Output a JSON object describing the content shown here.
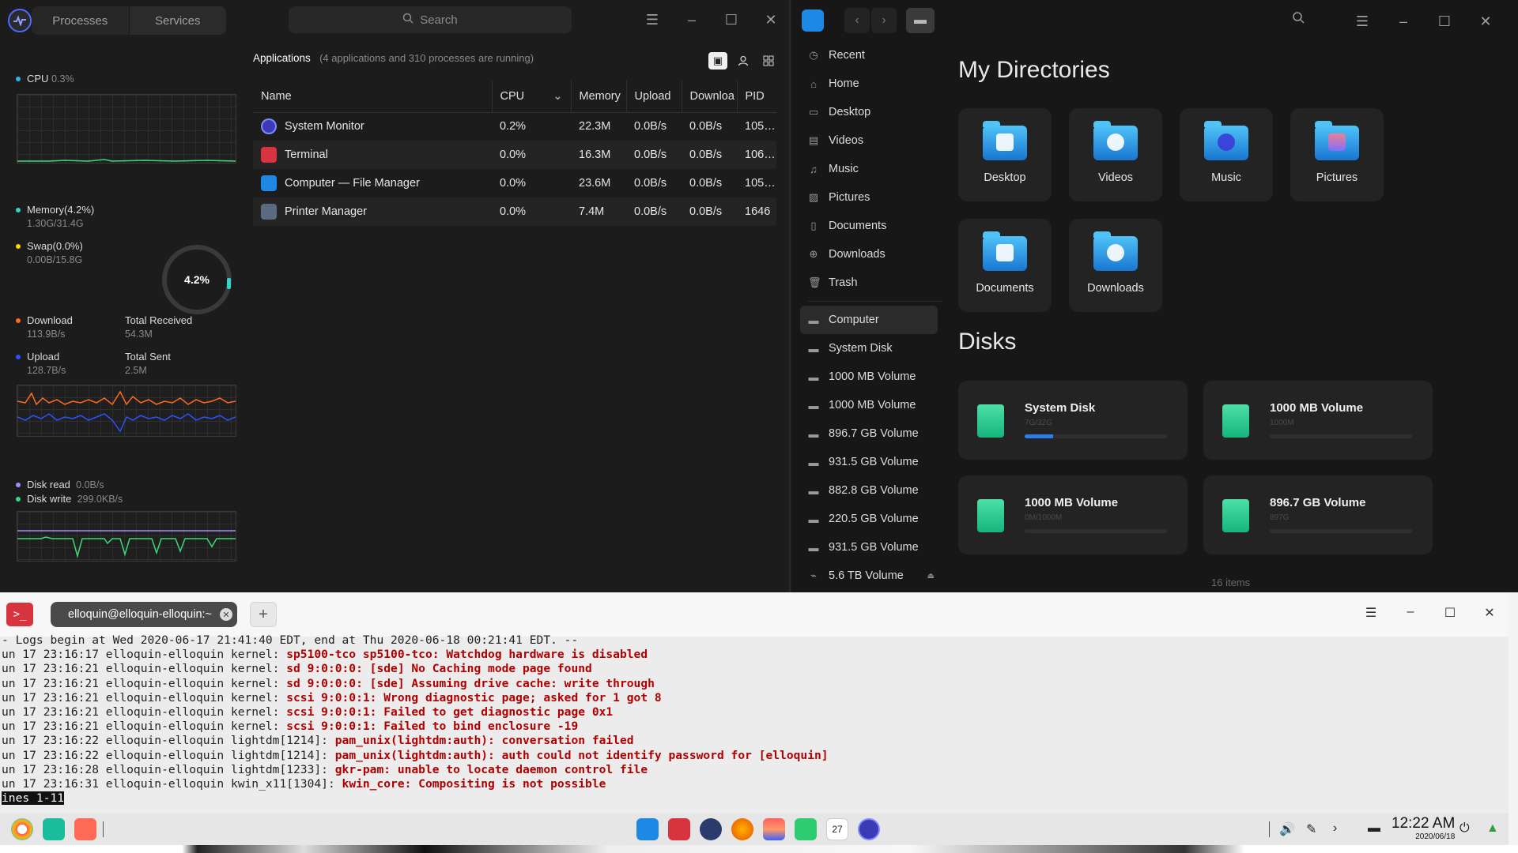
{
  "sysmon": {
    "tabs": [
      "Processes",
      "Services"
    ],
    "search_placeholder": "Search",
    "cpu": {
      "label": "CPU",
      "value": "0.3%"
    },
    "memory": {
      "label": "Memory(4.2%)",
      "detail": "1.30G/31.4G",
      "ring": "4.2%"
    },
    "swap": {
      "label": "Swap(0.0%)",
      "detail": "0.00B/15.8G"
    },
    "download": {
      "label": "Download",
      "value": "113.9B/s"
    },
    "total_received": {
      "label": "Total Received",
      "value": "54.3M"
    },
    "upload": {
      "label": "Upload",
      "value": "128.7B/s"
    },
    "total_sent": {
      "label": "Total Sent",
      "value": "2.5M"
    },
    "disk_read": {
      "label": "Disk read",
      "value": "0.0B/s"
    },
    "disk_write": {
      "label": "Disk write",
      "value": "299.0KB/s"
    },
    "apps_title": "Applications",
    "apps_summary": "(4 applications and 310 processes are running)",
    "columns": [
      "Name",
      "CPU",
      "Memory",
      "Upload",
      "Downloa",
      "PID"
    ],
    "rows": [
      {
        "name": "System Monitor",
        "cpu": "0.2%",
        "mem": "22.3M",
        "up": "0.0B/s",
        "down": "0.0B/s",
        "pid": "105…",
        "icon": "system-monitor-icon"
      },
      {
        "name": "Terminal",
        "cpu": "0.0%",
        "mem": "16.3M",
        "up": "0.0B/s",
        "down": "0.0B/s",
        "pid": "106…",
        "icon": "terminal-icon"
      },
      {
        "name": "Computer — File Manager",
        "cpu": "0.0%",
        "mem": "23.6M",
        "up": "0.0B/s",
        "down": "0.0B/s",
        "pid": "105…",
        "icon": "file-manager-icon"
      },
      {
        "name": "Printer Manager",
        "cpu": "0.0%",
        "mem": "7.4M",
        "up": "0.0B/s",
        "down": "0.0B/s",
        "pid": "1646",
        "icon": "printer-icon"
      }
    ],
    "colors": {
      "cpu": "#2fb6e8",
      "memory": "#2fd6c8",
      "swap": "#f5d90a",
      "download": "#ff6a1e",
      "upload": "#2b53ff",
      "disk_read": "#a38bff",
      "disk_write": "#3cd97a"
    }
  },
  "fm": {
    "sidebar": [
      "Recent",
      "Home",
      "Desktop",
      "Videos",
      "Music",
      "Pictures",
      "Documents",
      "Downloads",
      "Trash"
    ],
    "sidebar_devices": [
      "Computer",
      "System Disk",
      "1000 MB Volume",
      "1000 MB Volume",
      "896.7 GB Volume",
      "931.5 GB Volume",
      "882.8 GB Volume",
      "220.5 GB Volume",
      "931.5 GB Volume",
      "5.6 TB Volume"
    ],
    "directories_title": "My Directories",
    "directories": [
      "Desktop",
      "Videos",
      "Music",
      "Pictures",
      "Documents",
      "Downloads"
    ],
    "disks_title": "Disks",
    "disks": [
      {
        "name": "System Disk",
        "size": "7G/32G",
        "used": 0.2
      },
      {
        "name": "1000 MB Volume",
        "size": "1000M",
        "used": 0
      },
      {
        "name": "1000 MB Volume",
        "size": "0M/1000M",
        "used": 0
      },
      {
        "name": "896.7 GB Volume",
        "size": "897G",
        "used": 0
      }
    ],
    "status": "16 items"
  },
  "term": {
    "tab_title": "elloquin@elloquin-elloquin:~",
    "lines": [
      {
        "pre": "- Logs begin at Wed 2020-06-17 21:41:40 EDT, end at Thu 2020-06-18 00:21:41 EDT. --",
        "msg": ""
      },
      {
        "pre": "un 17 23:16:17 elloquin-elloquin kernel: ",
        "msg": "sp5100-tco sp5100-tco: Watchdog hardware is disabled"
      },
      {
        "pre": "un 17 23:16:21 elloquin-elloquin kernel: ",
        "msg": "sd 9:0:0:0: [sde] No Caching mode page found"
      },
      {
        "pre": "un 17 23:16:21 elloquin-elloquin kernel: ",
        "msg": "sd 9:0:0:0: [sde] Assuming drive cache: write through"
      },
      {
        "pre": "un 17 23:16:21 elloquin-elloquin kernel: ",
        "msg": "scsi 9:0:0:1: Wrong diagnostic page; asked for 1 got 8"
      },
      {
        "pre": "un 17 23:16:21 elloquin-elloquin kernel: ",
        "msg": "scsi 9:0:0:1: Failed to get diagnostic page 0x1"
      },
      {
        "pre": "un 17 23:16:21 elloquin-elloquin kernel: ",
        "msg": "scsi 9:0:0:1: Failed to bind enclosure -19"
      },
      {
        "pre": "un 17 23:16:22 elloquin-elloquin lightdm[1214]: ",
        "msg": "pam_unix(lightdm:auth): conversation failed"
      },
      {
        "pre": "un 17 23:16:22 elloquin-elloquin lightdm[1214]: ",
        "msg": "pam_unix(lightdm:auth): auth could not identify password for [elloquin]"
      },
      {
        "pre": "un 17 23:16:28 elloquin-elloquin lightdm[1233]: ",
        "msg": "gkr-pam: unable to locate daemon control file"
      },
      {
        "pre": "un 17 23:16:31 elloquin-elloquin kwin_x11[1304]: ",
        "msg": "kwin_core: Compositing is not possible"
      }
    ],
    "pager": "ines 1-11"
  },
  "dock": {
    "time": "12:22 AM",
    "date": "2020/06/18",
    "calendar_day": "27"
  }
}
